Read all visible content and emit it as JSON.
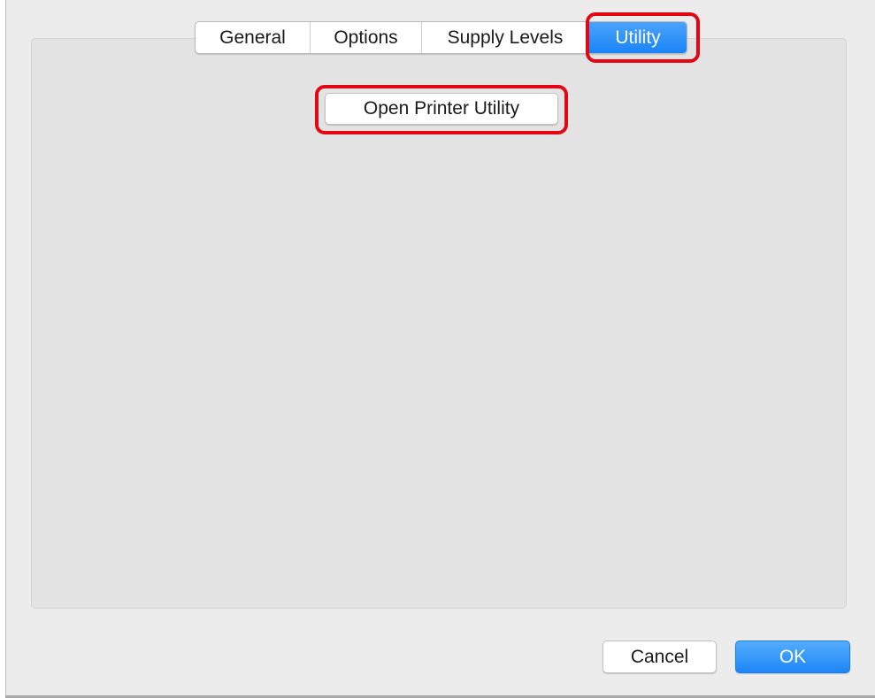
{
  "tabs": [
    {
      "label": "General",
      "selected": false
    },
    {
      "label": "Options",
      "selected": false
    },
    {
      "label": "Supply Levels",
      "selected": false
    },
    {
      "label": "Utility",
      "selected": true
    }
  ],
  "utility_panel": {
    "open_printer_utility_label": "Open Printer Utility"
  },
  "footer": {
    "cancel_label": "Cancel",
    "ok_label": "OK"
  },
  "colors": {
    "accent": "#1a84f6",
    "highlight_outline": "#e30613",
    "window_background": "#ececec",
    "panel_background": "#e3e3e3"
  }
}
